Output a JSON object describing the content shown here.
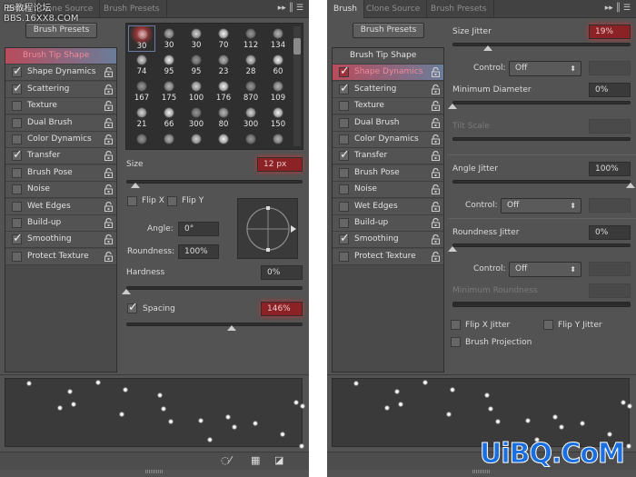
{
  "left": {
    "tabs": [
      "Brush",
      "Clone Source",
      "Brush Presets"
    ],
    "brush_presets_button": "Brush Presets",
    "items": [
      {
        "label": "Brush Tip Shape",
        "checkbox": false,
        "selected": true
      },
      {
        "label": "Shape Dynamics",
        "checked": true
      },
      {
        "label": "Scattering",
        "checked": true
      },
      {
        "label": "Texture",
        "checked": false
      },
      {
        "label": "Dual Brush",
        "checked": false
      },
      {
        "label": "Color Dynamics",
        "checked": false
      },
      {
        "label": "Transfer",
        "checked": true
      },
      {
        "label": "Brush Pose",
        "checked": false
      },
      {
        "label": "Noise",
        "checked": false
      },
      {
        "label": "Wet Edges",
        "checked": false
      },
      {
        "label": "Build-up",
        "checked": false
      },
      {
        "label": "Smoothing",
        "checked": true
      },
      {
        "label": "Protect Texture",
        "checked": false
      }
    ],
    "brush_sizes": [
      [
        "30",
        "30",
        "30",
        "70",
        "112",
        "134"
      ],
      [
        "74",
        "95",
        "95",
        "23",
        "28",
        "60"
      ],
      [
        "167",
        "175",
        "100",
        "176",
        "870",
        "109"
      ],
      [
        "21",
        "66",
        "300",
        "80",
        "300",
        "150"
      ],
      [
        "",
        "",
        "",
        "",
        "",
        ""
      ]
    ],
    "size_label": "Size",
    "size_value": "12 px",
    "size_slider": 0.05,
    "flip_x": "Flip X",
    "flip_y": "Flip Y",
    "angle_label": "Angle:",
    "angle_value": "0°",
    "roundness_label": "Roundness:",
    "roundness_value": "100%",
    "hardness_label": "Hardness",
    "hardness_value": "0%",
    "hardness_slider": 0,
    "spacing_label": "Spacing",
    "spacing_checked": true,
    "spacing_value": "146%",
    "spacing_slider": 0.6,
    "footer_icons": [
      "brush-eye-icon",
      "grid-icon",
      "new-preset-icon"
    ]
  },
  "right": {
    "tabs": [
      "Brush",
      "Clone Source",
      "Brush Presets"
    ],
    "brush_presets_button": "Brush Presets",
    "items": [
      {
        "label": "Brush Tip Shape",
        "checkbox": false
      },
      {
        "label": "Shape Dynamics",
        "checked": true,
        "selected": true
      },
      {
        "label": "Scattering",
        "checked": true
      },
      {
        "label": "Texture",
        "checked": false
      },
      {
        "label": "Dual Brush",
        "checked": false
      },
      {
        "label": "Color Dynamics",
        "checked": false
      },
      {
        "label": "Transfer",
        "checked": true
      },
      {
        "label": "Brush Pose",
        "checked": false
      },
      {
        "label": "Noise",
        "checked": false
      },
      {
        "label": "Wet Edges",
        "checked": false
      },
      {
        "label": "Build-up",
        "checked": false
      },
      {
        "label": "Smoothing",
        "checked": true
      },
      {
        "label": "Protect Texture",
        "checked": false
      }
    ],
    "size_jitter_label": "Size Jitter",
    "size_jitter_value": "19%",
    "size_jitter_slider": 0.2,
    "control_label": "Control:",
    "control_1": "Off",
    "min_diameter_label": "Minimum Diameter",
    "min_diameter_value": "0%",
    "min_diameter_slider": 0,
    "tilt_scale_label": "Tilt Scale",
    "angle_jitter_label": "Angle Jitter",
    "angle_jitter_value": "100%",
    "angle_jitter_slider": 1,
    "control_2": "Off",
    "roundness_jitter_label": "Roundness Jitter",
    "roundness_jitter_value": "0%",
    "roundness_jitter_slider": 0,
    "control_3": "Off",
    "min_roundness_label": "Minimum Roundness",
    "flip_x_jitter": "Flip X Jitter",
    "flip_y_jitter": "Flip Y Jitter",
    "brush_projection": "Brush Projection"
  },
  "watermarks": {
    "top_left_1": "PS教程论坛",
    "top_left_2": "BBS.16XX8.COM",
    "bottom_right": "UiBQ.CoM"
  },
  "colors": {
    "panel": "#535353",
    "highlight_red": "#8a2226",
    "selected_gradient_start": "#b84c5c"
  }
}
